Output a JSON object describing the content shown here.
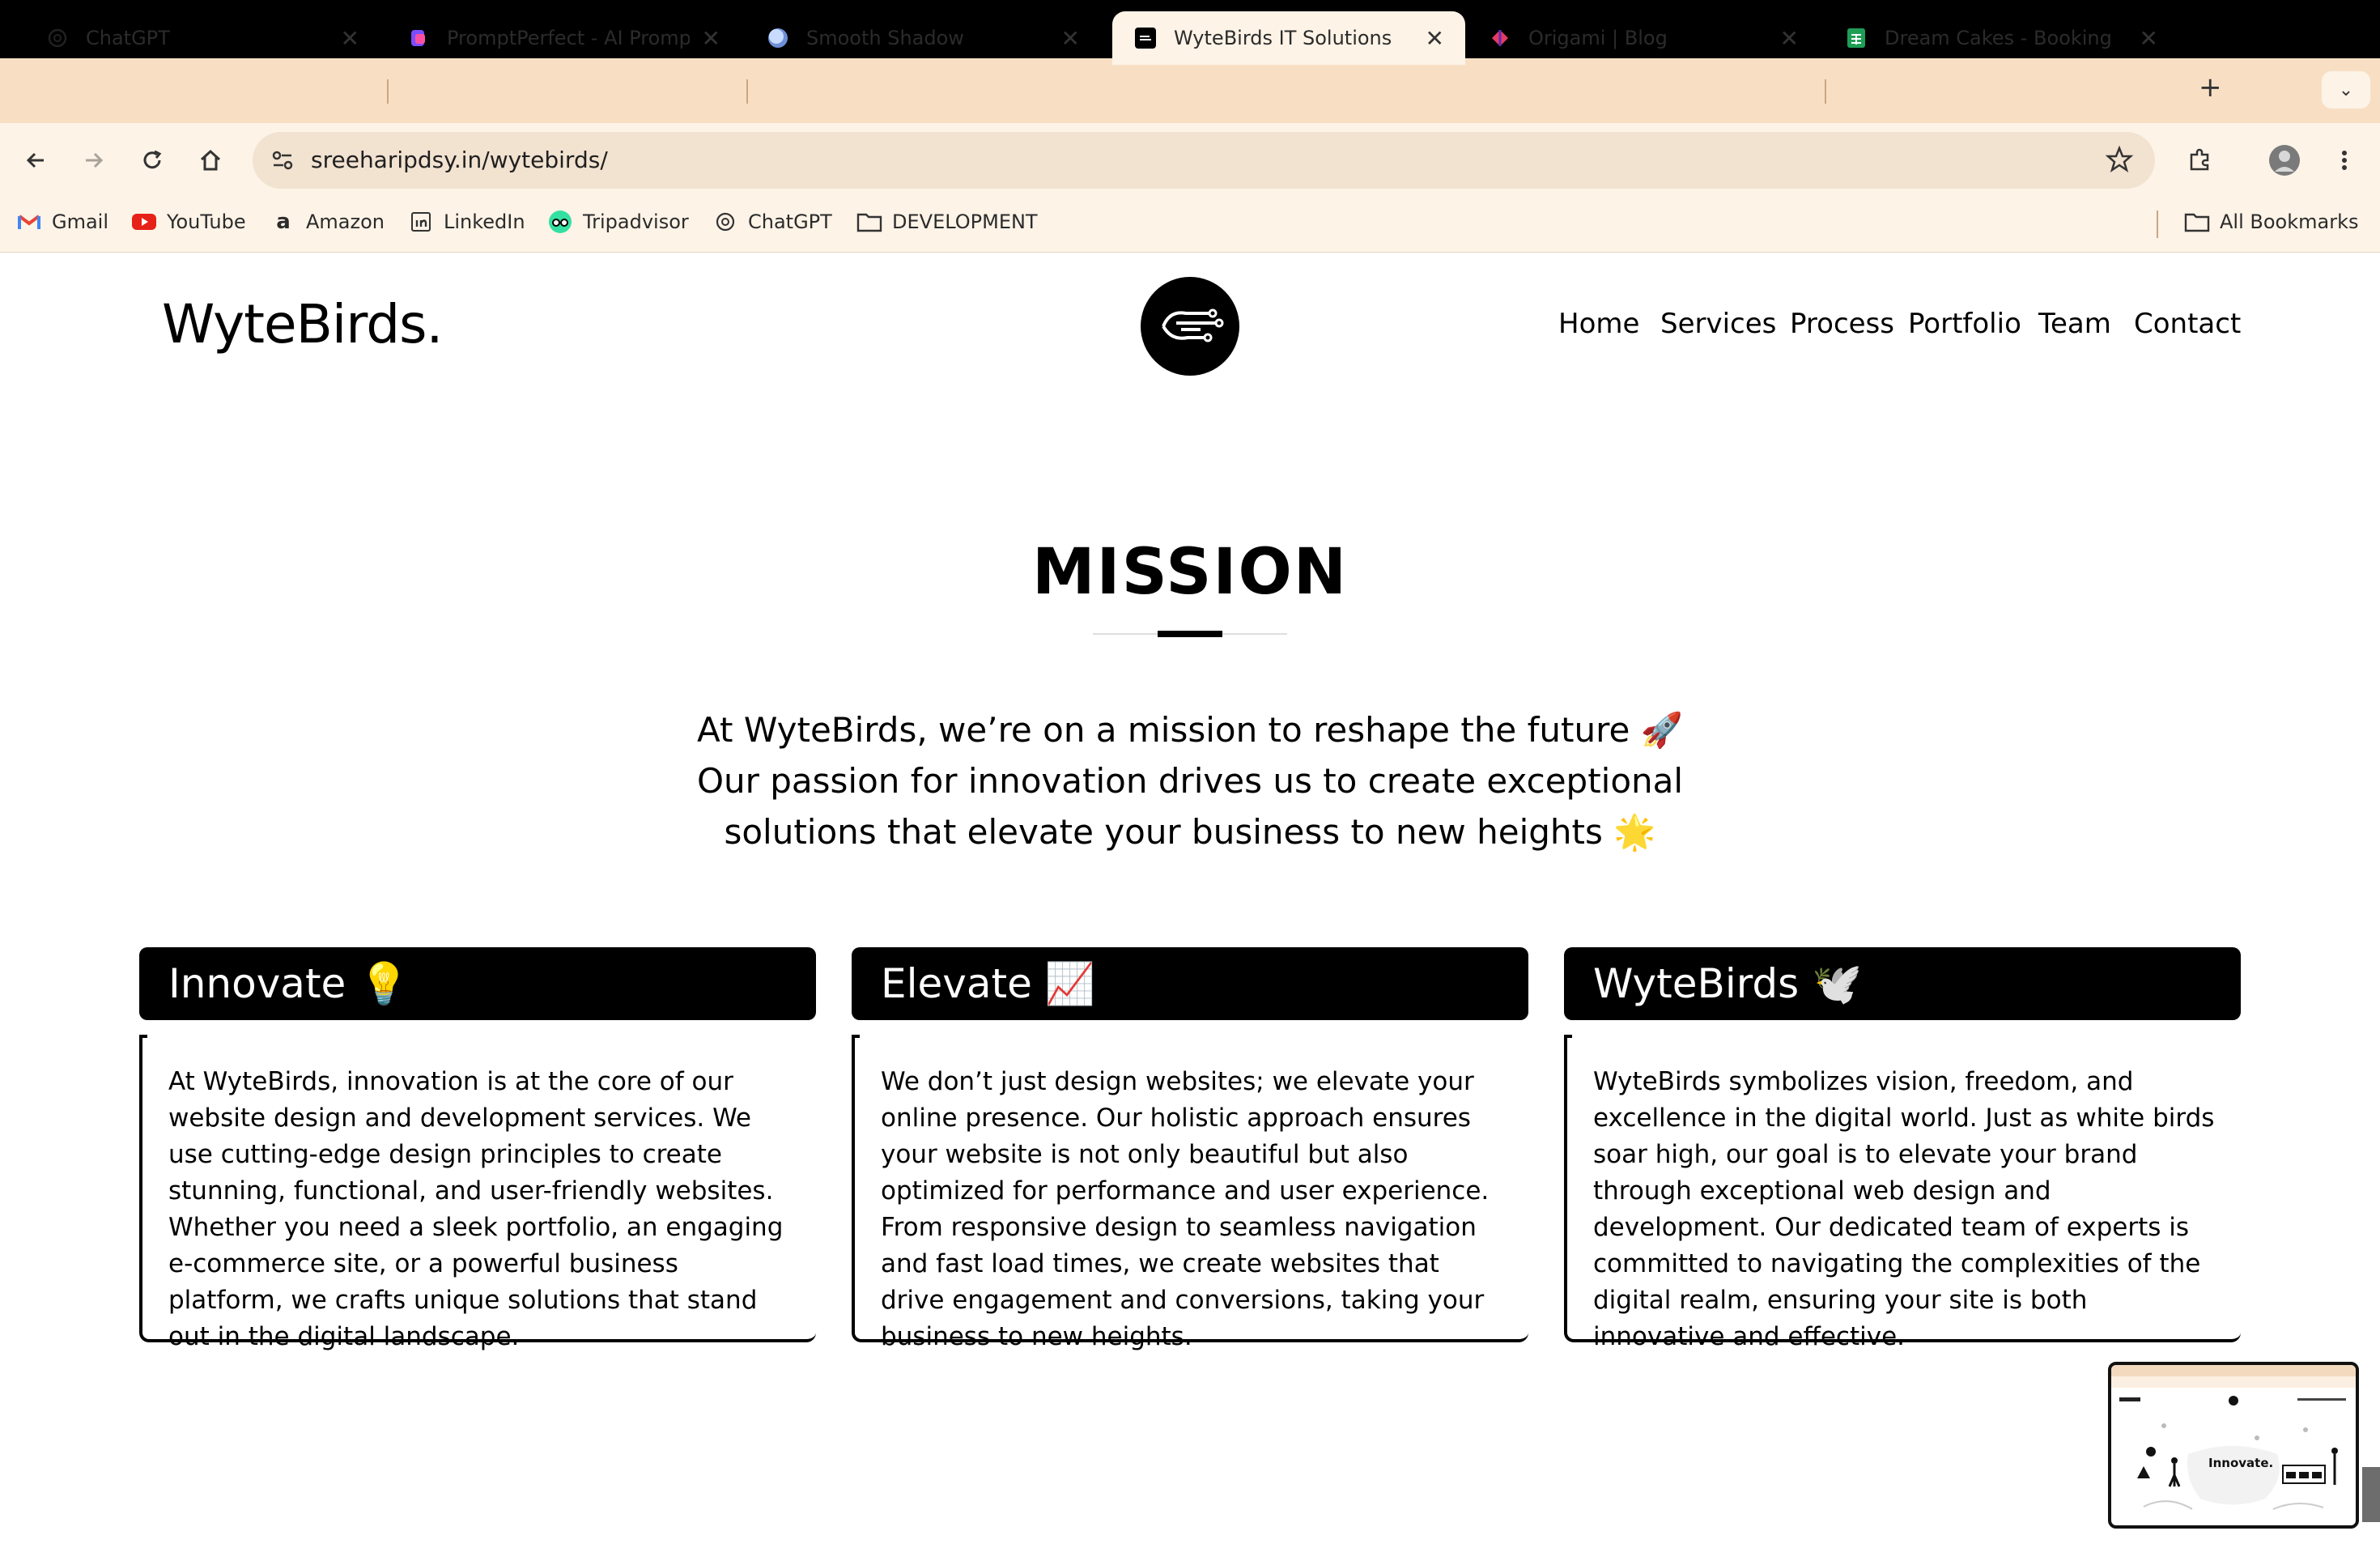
{
  "browser": {
    "tabs": [
      {
        "title": "ChatGPT",
        "icon": "openai-icon"
      },
      {
        "title": "PromptPerfect - AI Prompt",
        "icon": "promptperfect-icon"
      },
      {
        "title": "Smooth Shadow",
        "icon": "smooth-shadow-icon"
      },
      {
        "title": "WyteBirds IT Solutions",
        "icon": "wytebirds-icon",
        "active": true
      },
      {
        "title": "Origami | Blog",
        "icon": "origami-icon"
      },
      {
        "title": "Dream Cakes - Booking - G",
        "icon": "sheets-icon"
      }
    ],
    "new_tab": "+",
    "url": "sreeharipdsy.in/wytebirds/",
    "bookmarks": [
      {
        "label": "Gmail",
        "icon": "gmail-icon"
      },
      {
        "label": "YouTube",
        "icon": "youtube-icon"
      },
      {
        "label": "Amazon",
        "icon": "amazon-icon"
      },
      {
        "label": "LinkedIn",
        "icon": "linkedin-icon"
      },
      {
        "label": "Tripadvisor",
        "icon": "tripadvisor-icon"
      },
      {
        "label": "ChatGPT",
        "icon": "openai-icon"
      },
      {
        "label": "DEVELOPMENT",
        "icon": "folder-icon"
      }
    ],
    "all_bookmarks": "All Bookmarks"
  },
  "site": {
    "logo": "WyteBirds.",
    "nav": [
      "Home",
      "Services",
      "Process",
      "Portfolio",
      "Team",
      "Contact"
    ]
  },
  "mission": {
    "heading": "MISSION",
    "intro": "At WyteBirds, we’re on a mission to reshape the future 🚀 Our passion for innovation drives us to create exceptional solutions that elevate your business to new heights 🌟",
    "cards": [
      {
        "title": "Innovate 💡",
        "body": "At WyteBirds, innovation is at the core of our website design and development services. We use cutting-edge design principles to create stunning, functional, and user-friendly websites. Whether you need a sleek portfolio, an engaging e-commerce site, or a powerful business platform, we crafts unique solutions that stand out in the digital landscape."
      },
      {
        "title": "Elevate 📈",
        "body": "We don’t just design websites; we elevate your online presence. Our holistic approach ensures your website is not only beautiful but also optimized for performance and user experience. From responsive design to seamless navigation and fast load times, we create websites that drive engagement and conversions, taking your business to new heights."
      },
      {
        "title": "WyteBirds 🕊️",
        "body": "WyteBirds symbolizes vision, freedom, and excellence in the digital world. Just as white birds soar high, our goal is to elevate your brand through exceptional web design and development. Our dedicated team of experts is committed to navigating the complexities of the digital realm, ensuring your site is both innovative and effective."
      }
    ]
  },
  "preview": {
    "label": "Innovate."
  }
}
